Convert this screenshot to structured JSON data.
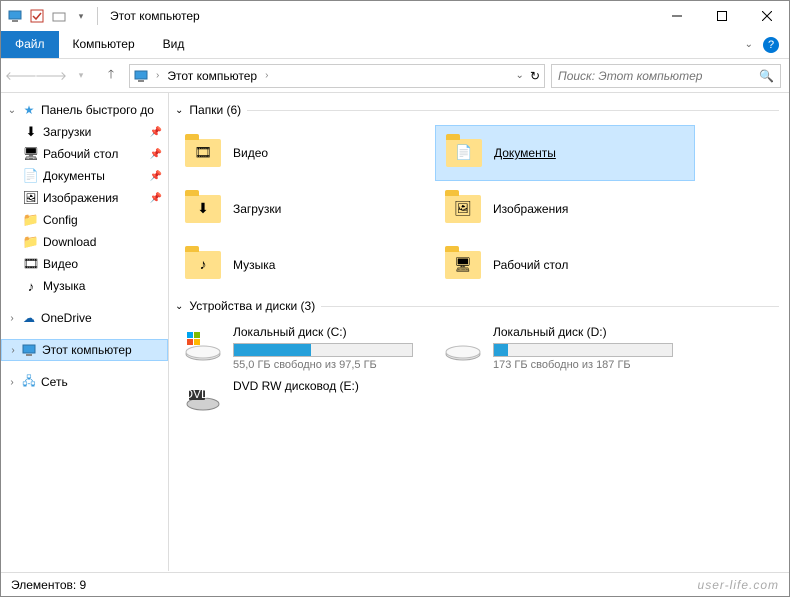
{
  "title": "Этот компьютер",
  "menu": {
    "file": "Файл",
    "computer": "Компьютер",
    "view": "Вид"
  },
  "breadcrumb": "Этот компьютер",
  "search_placeholder": "Поиск: Этот компьютер",
  "sidebar": {
    "quick": "Панель быстрого до",
    "items": [
      {
        "label": "Загрузки",
        "pin": true,
        "icon": "download"
      },
      {
        "label": "Рабочий стол",
        "pin": true,
        "icon": "desktop"
      },
      {
        "label": "Документы",
        "pin": true,
        "icon": "doc"
      },
      {
        "label": "Изображения",
        "pin": true,
        "icon": "img"
      },
      {
        "label": "Config",
        "pin": false,
        "icon": "folder"
      },
      {
        "label": "Download",
        "pin": false,
        "icon": "folder"
      },
      {
        "label": "Видео",
        "pin": false,
        "icon": "video"
      },
      {
        "label": "Музыка",
        "pin": false,
        "icon": "music"
      }
    ],
    "onedrive": "OneDrive",
    "this_pc": "Этот компьютер",
    "network": "Сеть"
  },
  "groups": {
    "folders_title": "Папки (6)",
    "folders": [
      {
        "label": "Видео",
        "icon": "video"
      },
      {
        "label": "Документы",
        "icon": "doc",
        "selected": true
      },
      {
        "label": "Загрузки",
        "icon": "download"
      },
      {
        "label": "Изображения",
        "icon": "img"
      },
      {
        "label": "Музыка",
        "icon": "music"
      },
      {
        "label": "Рабочий стол",
        "icon": "desktop"
      }
    ],
    "drives_title": "Устройства и диски (3)",
    "drives": [
      {
        "name": "Локальный диск (C:)",
        "info": "55,0 ГБ свободно из 97,5 ГБ",
        "fill": 43,
        "type": "hdd-win"
      },
      {
        "name": "Локальный диск (D:)",
        "info": "173 ГБ свободно из 187 ГБ",
        "fill": 8,
        "type": "hdd"
      },
      {
        "name": "DVD RW дисковод (E:)",
        "info": "",
        "fill": -1,
        "type": "dvd"
      }
    ]
  },
  "status": "Элементов: 9",
  "watermark": "user-life.com"
}
